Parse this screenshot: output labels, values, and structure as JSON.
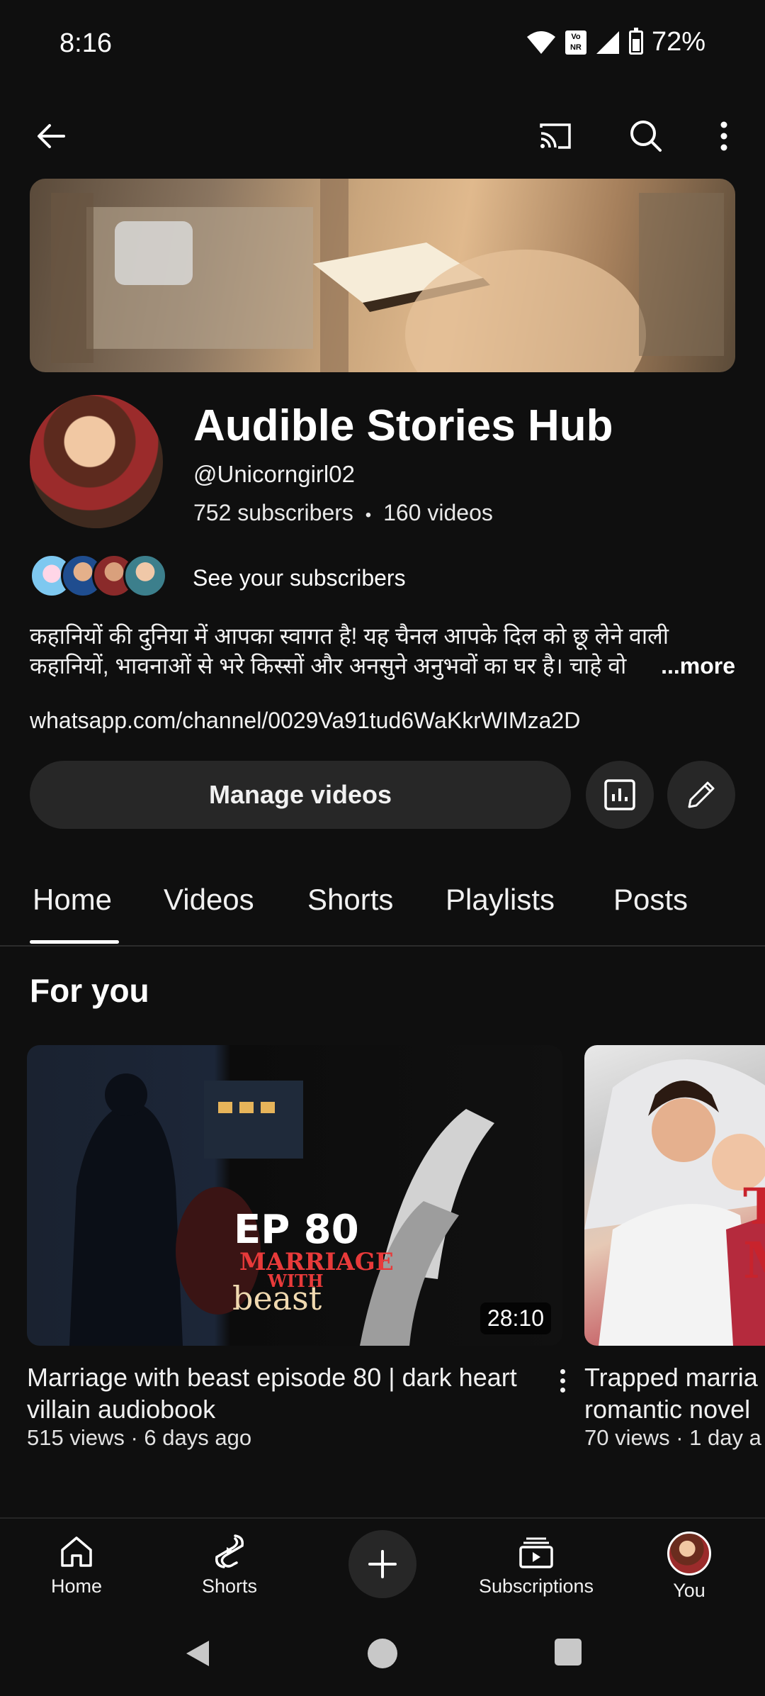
{
  "status_bar": {
    "time": "8:16",
    "network_badge": "Vo NR",
    "battery": "72%"
  },
  "top_bar": {
    "icons": [
      "back-arrow-icon",
      "cast-icon",
      "search-icon",
      "more-vertical-icon"
    ]
  },
  "channel": {
    "name": "Audible Stories Hub",
    "handle": "@Unicorngirl02",
    "subscribers": "752 subscribers",
    "separator": "•",
    "videos": "160 videos",
    "see_subscribers": "See your subscribers",
    "description_line1": "कहानियों की दुनिया में आपका स्वागत है! यह चैनल आपके दिल को छू लेने वाली",
    "description_line2": "कहानियों, भावनाओं से भरे किस्सों और अनसुने अनुभवों का घर है। चाहे वो",
    "more": "...more",
    "link": "whatsapp.com/channel/0029Va91tud6WaKkrWIMza2D"
  },
  "actions": {
    "manage_videos": "Manage videos"
  },
  "tabs": [
    "Home",
    "Videos",
    "Shorts",
    "Playlists",
    "Posts"
  ],
  "active_tab": "Home",
  "section": {
    "title": "For you"
  },
  "videos": [
    {
      "thumb_text_1": "EP 80",
      "thumb_text_2": "MARRIAGE",
      "thumb_text_3": "WITH",
      "thumb_text_4": "beast",
      "duration": "28:10",
      "title": "Marriage with beast episode 80 | dark heart villain audiobook",
      "meta": "515 views · 6 days ago"
    },
    {
      "thumb_text": "T M",
      "title": "Trapped marria romantic novel",
      "title_line1": "Trapped marria",
      "title_line2": "romantic novel",
      "meta": "70 views · 1 day a"
    }
  ],
  "bottom_nav": {
    "home": "Home",
    "shorts": "Shorts",
    "subscriptions": "Subscriptions",
    "you": "You"
  },
  "colors": {
    "background": "#0f0f0f",
    "surface": "#272727",
    "text": "#f1f1f1",
    "thumb_red": "#c8232c"
  }
}
